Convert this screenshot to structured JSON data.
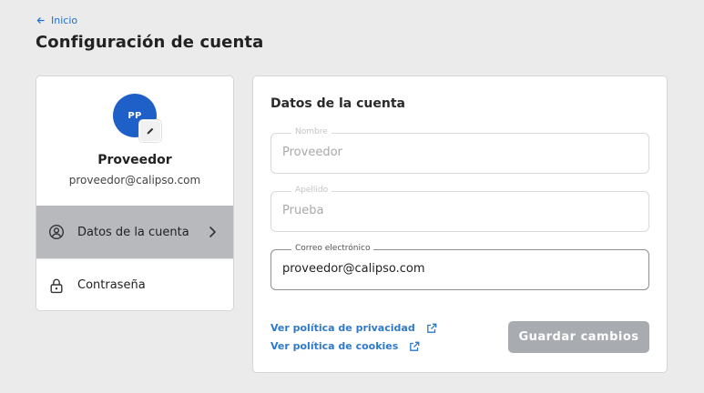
{
  "header": {
    "back_label": "Inicio",
    "back_icon": "arrow-left-icon",
    "title": "Configuración de cuenta"
  },
  "profile": {
    "initials": "PP",
    "avatar_color": "#1f5fc8",
    "edit_icon": "pencil-icon",
    "name": "Proveedor",
    "email": "proveedor@calipso.com"
  },
  "menu": {
    "items": [
      {
        "label": "Datos de la cuenta",
        "icon": "user-circle-icon",
        "active": true,
        "has_chevron": true
      },
      {
        "label": "Contraseña",
        "icon": "lock-icon",
        "active": false,
        "has_chevron": false
      }
    ]
  },
  "account": {
    "title": "Datos de la cuenta",
    "fields": [
      {
        "label": "Nombre",
        "value": "Proveedor",
        "disabled": true
      },
      {
        "label": "Apellido",
        "value": "Prueba",
        "disabled": true
      },
      {
        "label": "Correo electrónico",
        "value": "proveedor@calipso.com",
        "disabled": false
      }
    ],
    "links": [
      {
        "label": "Ver política de privacidad",
        "icon": "external-link-icon"
      },
      {
        "label": "Ver política de cookies",
        "icon": "external-link-icon"
      }
    ],
    "save_label": "Guardar cambios"
  },
  "colors": {
    "accent": "#1e6fd0",
    "link": "#2f79c9",
    "active_menu_bg": "#b7b9bd",
    "button_disabled_bg": "#a8abb0",
    "page_bg": "#ebebeb"
  }
}
